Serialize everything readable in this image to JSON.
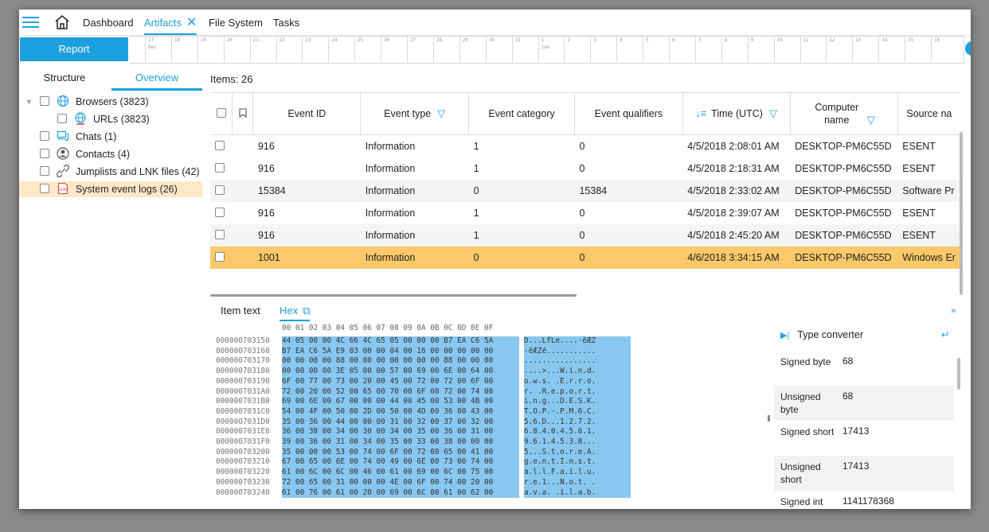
{
  "nav": {
    "tabs": [
      {
        "label": "Dashboard"
      },
      {
        "label": "Artifacts"
      },
      {
        "label": "File System"
      },
      {
        "label": "Tasks"
      }
    ],
    "close_glyph": "✕"
  },
  "report_label": "Report",
  "timeline": {
    "ticks": [
      "17",
      "18",
      "19",
      "20",
      "21",
      "22",
      "23",
      "24",
      "25",
      "26",
      "27",
      "28",
      "29",
      "30",
      "31",
      "1",
      "2",
      "3",
      "4",
      "5",
      "6",
      "7",
      "8",
      "9",
      "10",
      "11",
      "12",
      "13",
      "14",
      "15",
      "16"
    ],
    "month_dec": "Dec",
    "month_jan": "Jan"
  },
  "left": {
    "tabs": [
      {
        "label": "Structure"
      },
      {
        "label": "Overview"
      }
    ],
    "tree": [
      {
        "label": "Browsers (3823)",
        "icon": "globe-icon"
      },
      {
        "label": "URLs (3823)",
        "icon": "url-icon"
      },
      {
        "label": "Chats (1)",
        "icon": "chat-icon"
      },
      {
        "label": "Contacts (4)",
        "icon": "contact-icon"
      },
      {
        "label": "Jumplists and LNK files (42)",
        "icon": "link-icon"
      },
      {
        "label": "System event logs (26)",
        "icon": "log-icon",
        "selected": true
      }
    ]
  },
  "items_label": "Items: 26",
  "grid": {
    "columns": [
      "Event ID",
      "Event type",
      "Event category",
      "Event qualifiers",
      "Time (UTC)",
      "Computer name",
      "Source na"
    ],
    "rows": [
      [
        "916",
        "Information",
        "1",
        "0",
        "4/5/2018 2:08:01 AM",
        "DESKTOP-PM6C55D",
        "ESENT"
      ],
      [
        "916",
        "Information",
        "1",
        "0",
        "4/5/2018 2:18:31 AM",
        "DESKTOP-PM6C55D",
        "ESENT"
      ],
      [
        "15384",
        "Information",
        "0",
        "15384",
        "4/5/2018 2:33:02 AM",
        "DESKTOP-PM6C55D",
        "Software Pr"
      ],
      [
        "916",
        "Information",
        "1",
        "0",
        "4/5/2018 2:39:07 AM",
        "DESKTOP-PM6C55D",
        "ESENT"
      ],
      [
        "916",
        "Information",
        "1",
        "0",
        "4/5/2018 2:45:20 AM",
        "DESKTOP-PM6C55D",
        "ESENT"
      ],
      [
        "1001",
        "Information",
        "0",
        "0",
        "4/6/2018 3:34:15 AM",
        "DESKTOP-PM6C55D",
        "Windows Er"
      ]
    ]
  },
  "bottom_tabs": [
    {
      "label": "Item text"
    },
    {
      "label": "Hex"
    }
  ],
  "hex": {
    "header": "00 01 02 03 04 05 06 07 08 09 0A 0B 0C 0D 0E 0F",
    "offsets": [
      "000000703150",
      "000000703160",
      "000000703170",
      "000000703180",
      "000000703190",
      "0000007031A0",
      "0000007031B0",
      "0000007031C0",
      "0000007031D0",
      "0000007031E0",
      "0000007031F0",
      "000000703200",
      "000000703210",
      "000000703220",
      "000000703230",
      "000000703240"
    ],
    "bytes": [
      "44 05 00 00 4C 66 4C 65 05 00 00 00 B7 EA C6 5A",
      "B7 EA C6 5A E9 03 00 00 04 00 16 00 00 00 00 00",
      "00 00 00 00 88 00 00 00 00 00 00 00 88 00 00 00",
      "00 00 00 00 3E 05 00 00 57 00 69 00 6E 00 64 00",
      "6F 00 77 00 73 00 20 00 45 00 72 00 72 00 6F 00",
      "72 00 20 00 52 00 65 00 70 00 6F 00 72 00 74 00",
      "69 00 6E 00 67 00 00 00 44 00 45 00 53 00 4B 00",
      "54 00 4F 00 50 00 2D 00 50 00 4D 00 36 00 43 00",
      "35 00 36 00 44 00 00 00 31 00 32 00 37 00 32 00",
      "36 00 38 00 34 00 30 00 34 00 35 00 36 00 31 00",
      "39 00 36 00 31 00 34 00 35 00 33 00 38 00 00 00",
      "35 00 00 00 53 00 74 00 6F 00 72 00 65 00 41 00",
      "67 00 65 00 6E 00 74 00 49 00 6E 00 73 00 74 00",
      "61 00 6C 00 6C 00 46 00 61 00 69 00 6C 00 75 00",
      "72 00 65 00 31 00 00 00 4E 00 6F 00 74 00 20 00",
      "61 00 76 00 61 00 20 00 69 00 6C 00 61 00 62 00"
    ],
    "ascii": [
      "D...LfLe....·ëÆZ",
      "·ëÆZé...........",
      "................",
      "....>...W.i.n.d.",
      "o.w.s. .E.r.r.o.",
      "r. .R.e.p.o.r.t.",
      "i.n.g...D.E.S.K.",
      "T.O.P.-.P.M.6.C.",
      "5.6.D...1.2.7.2.",
      "6.8.4.0.4.5.6.1.",
      "9.6.1.4.5.3.8...",
      "5...S.t.o.r.e.A.",
      "g.e.n.t.I.n.s.t.",
      "a.l.l.F.a.i.l.u.",
      "r.e.1...N.o.t. .",
      "a.v.a. .i.l.a.b."
    ]
  },
  "type_converter": {
    "title": "Type converter",
    "rows": [
      {
        "label": "Signed byte",
        "value": "68"
      },
      {
        "label": "Unsigned byte",
        "value": "68"
      },
      {
        "label": "Signed short",
        "value": "17413"
      },
      {
        "label": "Unsigned short",
        "value": "17413"
      },
      {
        "label": "Signed int",
        "value": "1141178368"
      }
    ]
  }
}
